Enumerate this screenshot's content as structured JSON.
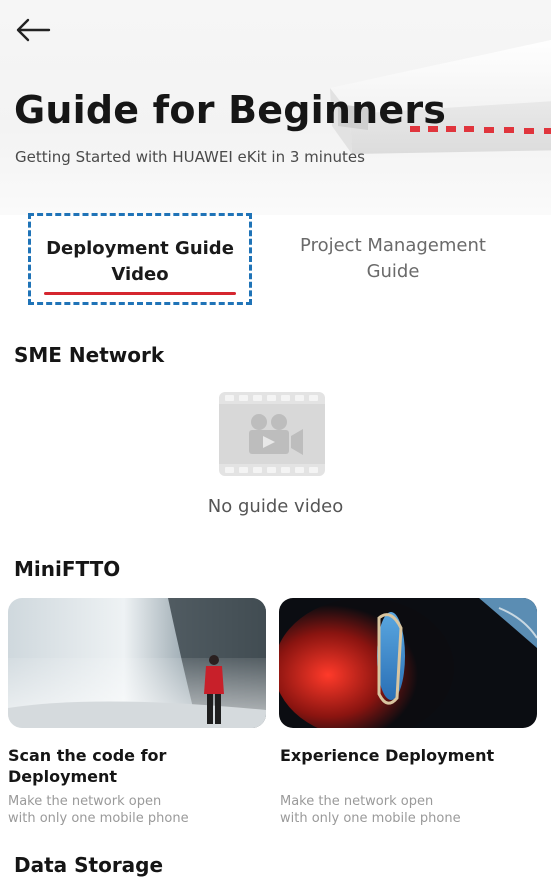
{
  "header": {
    "title": "Guide for Beginners",
    "subtitle": "Getting Started with HUAWEI eKit in 3 minutes"
  },
  "tabs": [
    {
      "label_line1": "Deployment Guide",
      "label_line2": "Video",
      "active": true
    },
    {
      "label_line1": "Project Management",
      "label_line2": "Guide",
      "active": false
    }
  ],
  "sections": {
    "sme": {
      "title": "SME Network",
      "empty_text": "No guide video"
    },
    "miniftto": {
      "title": "MiniFTTO",
      "cards": [
        {
          "title_line1": "Scan the code for",
          "title_line2": "Deployment",
          "desc_line1": "Make the network open",
          "desc_line2": "with only one mobile phone"
        },
        {
          "title_line1": "Experience Deployment",
          "title_line2": "",
          "desc_line1": "Make the network open",
          "desc_line2": "with only one mobile phone"
        }
      ]
    },
    "storage": {
      "title": "Data Storage"
    }
  },
  "colors": {
    "accent_red": "#d5262f",
    "focus_blue": "#1f73b7"
  }
}
